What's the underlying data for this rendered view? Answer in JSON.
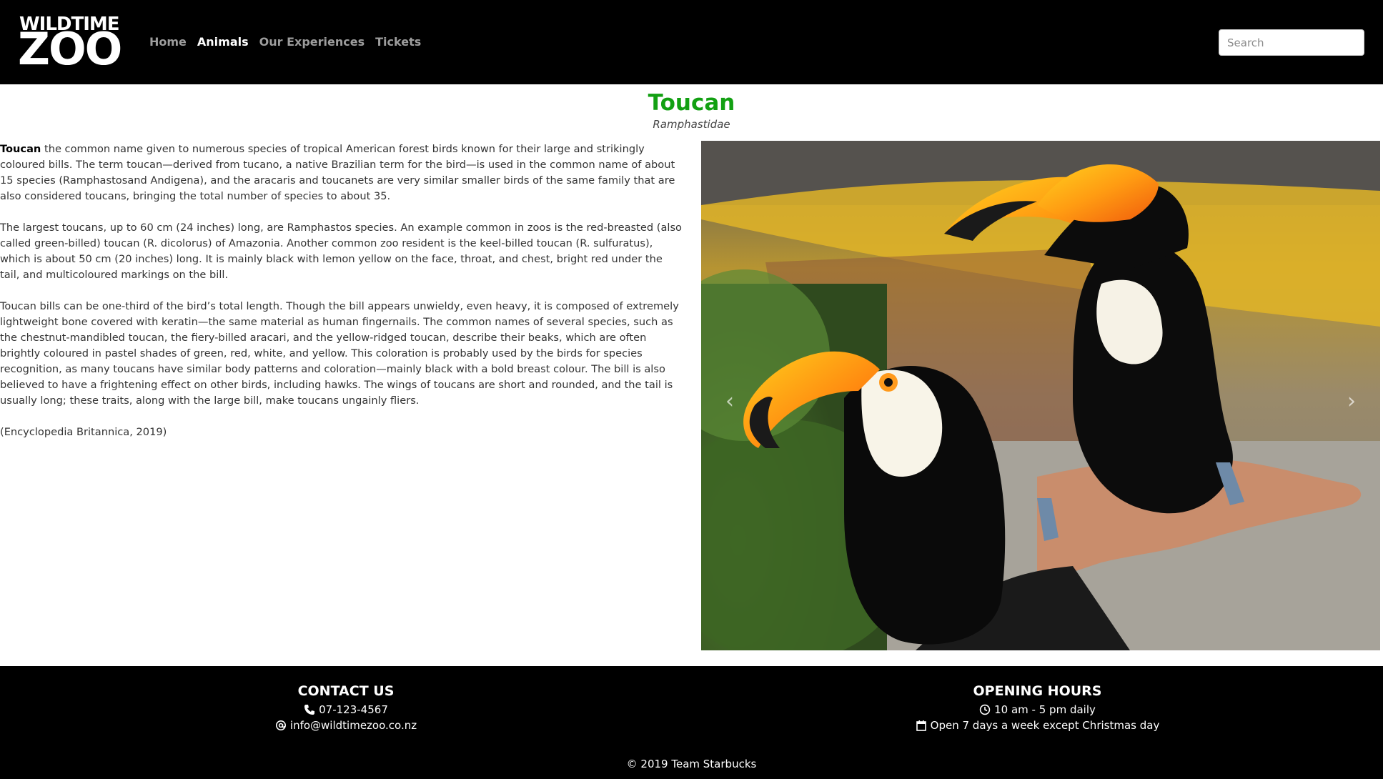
{
  "navbar": {
    "logo_top": "WILDTIME",
    "logo_bottom": "ZOO",
    "links": [
      {
        "label": "Home",
        "active": false
      },
      {
        "label": "Animals",
        "active": true
      },
      {
        "label": "Our Experiences",
        "active": false
      },
      {
        "label": "Tickets",
        "active": false
      }
    ],
    "search_placeholder": "Search"
  },
  "animal": {
    "name": "Toucan",
    "scientific_name": "Ramphastidae",
    "intro_bold": "Toucan",
    "paragraph_1_rest": " the common name given to numerous species of tropical American forest birds known for their large and strikingly coloured bills. The term toucan—derived from tucano, a native Brazilian term for the bird—is used in the common name of about 15 species (Ramphastosand Andigena), and the aracaris and toucanets are very similar smaller birds of the same family that are also considered toucans, bringing the total number of species to about 35.",
    "paragraph_2": "The largest toucans, up to 60 cm (24 inches) long, are Ramphastos species. An example common in zoos is the red-breasted (also called green-billed) toucan (R. dicolorus) of Amazonia. Another common zoo resident is the keel-billed toucan (R. sulfuratus), which is about 50 cm (20 inches) long. It is mainly black with lemon yellow on the face, throat, and chest, bright red under the tail, and multicoloured markings on the bill.",
    "paragraph_3": "Toucan bills can be one-third of the bird’s total length. Though the bill appears unwieldy, even heavy, it is composed of extremely lightweight bone covered with keratin—the same material as human fingernails. The common names of several species, such as the chestnut-mandibled toucan, the fiery-billed aracari, and the yellow-ridged toucan, describe their beaks, which are often brightly coloured in pastel shades of green, red, white, and yellow. This coloration is probably used by the birds for species recognition, as many toucans have similar body patterns and coloration—mainly black with a bold breast colour. The bill is also believed to have a frightening effect on other birds, including hawks. The wings of toucans are short and rounded, and the tail is usually long; these traits, along with the large bill, make toucans ungainly fliers.",
    "citation": "(Encyclopedia Britannica, 2019)"
  },
  "carousel": {
    "prev_icon": "chevron-left-icon",
    "next_icon": "chevron-right-icon",
    "prev_glyph": "‹",
    "next_glyph": "›"
  },
  "footer": {
    "contact_heading": "CONTACT US",
    "phone": "07-123-4567",
    "email": "info@wildtimezoo.co.nz",
    "hours_heading": "OPENING HOURS",
    "hours": "10 am - 5 pm daily",
    "days": "Open 7 days a week except Christmas day",
    "copyright": "© 2019 Team Starbucks"
  },
  "colors": {
    "title_green": "#12a012",
    "nav_bg": "#000000",
    "nav_inactive": "#9d9d9d"
  }
}
